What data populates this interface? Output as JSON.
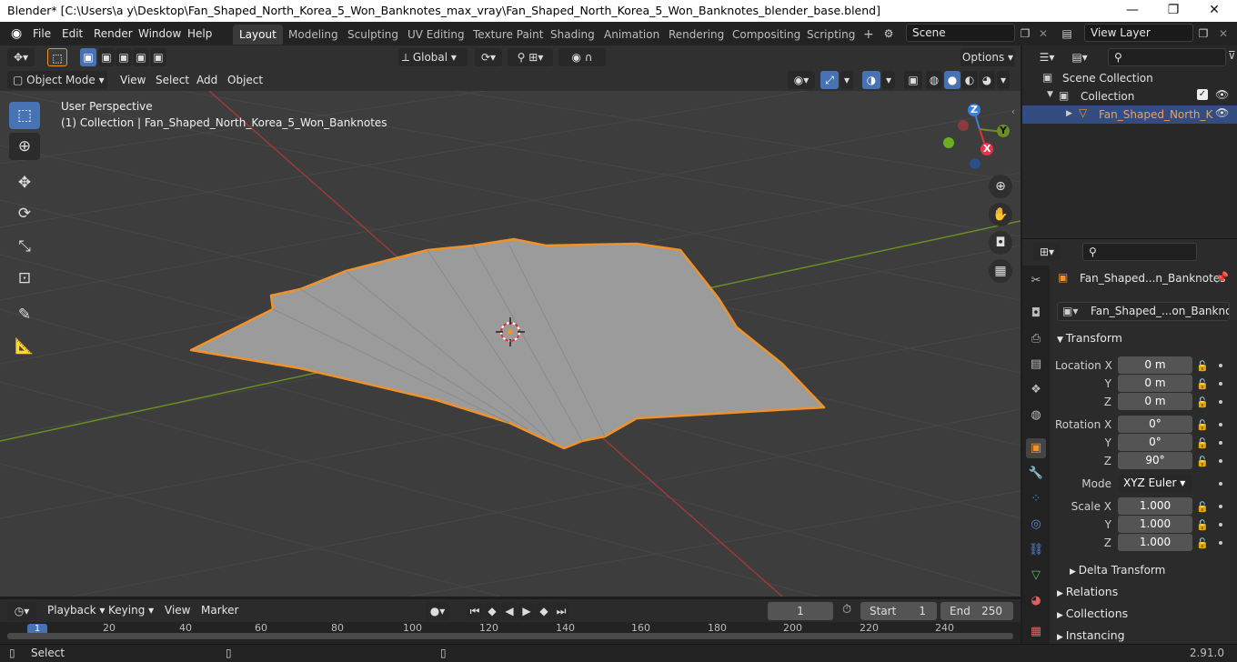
{
  "titlebar": {
    "title": "Blender* [C:\\Users\\a y\\Desktop\\Fan_Shaped_North_Korea_5_Won_Banknotes_max_vray\\Fan_Shaped_North_Korea_5_Won_Banknotes_blender_base.blend]",
    "minimize": "—",
    "maximize": "❐",
    "close": "✕"
  },
  "menus": [
    "File",
    "Edit",
    "Render",
    "Window",
    "Help"
  ],
  "workspaces": [
    "Layout",
    "Modeling",
    "Sculpting",
    "UV Editing",
    "Texture Paint",
    "Shading",
    "Animation",
    "Rendering",
    "Compositing",
    "Scripting"
  ],
  "active_workspace": "Layout",
  "scene": {
    "name": "Scene",
    "view_layer": "View Layer"
  },
  "viewport_header": {
    "transform_orientation": "Global",
    "options": "Options",
    "mode": "Object Mode",
    "menus": [
      "View",
      "Select",
      "Add",
      "Object"
    ]
  },
  "viewport": {
    "perspective": "User Perspective",
    "collection_info": "(1) Collection | Fan_Shaped_North_Korea_5_Won_Banknotes",
    "gizmo": {
      "x": "X",
      "y": "Y",
      "z": "Z"
    }
  },
  "tools": [
    "select-box",
    "cursor",
    "move",
    "rotate",
    "scale",
    "transform",
    "annotate",
    "measure"
  ],
  "outliner": {
    "scene_collection": "Scene Collection",
    "collection": "Collection",
    "object": "Fan_Shaped_North_K"
  },
  "properties": {
    "object_name": "Fan_Shaped...n_Banknotes",
    "datablock_name": "Fan_Shaped_...on_Banknotes",
    "transform_title": "Transform",
    "location": {
      "label": "Location X",
      "x": "0 m",
      "y": "0 m",
      "z": "0 m"
    },
    "rotation": {
      "label": "Rotation X",
      "x": "0°",
      "y": "0°",
      "z": "90°"
    },
    "mode_label": "Mode",
    "mode_value": "XYZ Euler",
    "scale": {
      "label": "Scale X",
      "x": "1.000",
      "y": "1.000",
      "z": "1.000"
    },
    "axis_labels": {
      "y": "Y",
      "z": "Z"
    },
    "delta_transform": "Delta Transform",
    "relations": "Relations",
    "collections": "Collections",
    "instancing": "Instancing"
  },
  "timeline": {
    "menus": [
      "Playback",
      "Keying",
      "View",
      "Marker"
    ],
    "current_frame": "1",
    "start_label": "Start",
    "start": "1",
    "end_label": "End",
    "end": "250",
    "ruler": [
      "20",
      "40",
      "60",
      "80",
      "100",
      "120",
      "140",
      "160",
      "180",
      "200",
      "220",
      "240"
    ],
    "playhead": "1"
  },
  "statusbar": {
    "left": "Select",
    "version": "2.91.0"
  },
  "colors": {
    "accent": "#4772b3",
    "selection_outline": "#f0922a",
    "x_axis": "#9a3a3a",
    "y_axis": "#6b8e23",
    "z_axis": "#3d7fd6"
  }
}
